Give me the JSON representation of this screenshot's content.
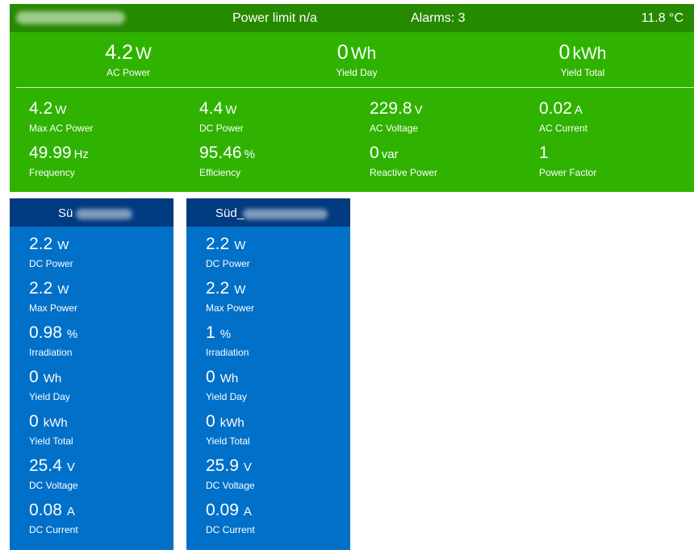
{
  "inverter": {
    "power_limit": "Power limit n/a",
    "alarms": "Alarms: 3",
    "temperature": "11.8 °C",
    "top_metrics": [
      {
        "value": "4.2",
        "unit": "W",
        "label": "AC Power"
      },
      {
        "value": "0",
        "unit": "Wh",
        "label": "Yield Day"
      },
      {
        "value": "0",
        "unit": "kWh",
        "label": "Yield Total"
      }
    ],
    "metrics": [
      {
        "value": "4.2",
        "unit": "W",
        "label": "Max AC Power"
      },
      {
        "value": "4.4",
        "unit": "W",
        "label": "DC Power"
      },
      {
        "value": "229.8",
        "unit": "V",
        "label": "AC Voltage"
      },
      {
        "value": "0.02",
        "unit": "A",
        "label": "AC Current"
      },
      {
        "value": "49.99",
        "unit": "Hz",
        "label": "Frequency"
      },
      {
        "value": "95.46",
        "unit": "%",
        "label": "Efficiency"
      },
      {
        "value": "0",
        "unit": "var",
        "label": "Reactive Power"
      },
      {
        "value": "1",
        "unit": "",
        "label": "Power Factor"
      }
    ]
  },
  "strings": [
    {
      "title": "Sü",
      "metrics": [
        {
          "value": "2.2",
          "unit": "W",
          "label": "DC Power"
        },
        {
          "value": "2.2",
          "unit": "W",
          "label": "Max Power"
        },
        {
          "value": "0.98",
          "unit": "%",
          "label": "Irradiation"
        },
        {
          "value": "0",
          "unit": "Wh",
          "label": "Yield Day"
        },
        {
          "value": "0",
          "unit": "kWh",
          "label": "Yield Total"
        },
        {
          "value": "25.4",
          "unit": "V",
          "label": "DC Voltage"
        },
        {
          "value": "0.08",
          "unit": "A",
          "label": "DC Current"
        }
      ]
    },
    {
      "title": "Süd_",
      "metrics": [
        {
          "value": "2.2",
          "unit": "W",
          "label": "DC Power"
        },
        {
          "value": "2.2",
          "unit": "W",
          "label": "Max Power"
        },
        {
          "value": "1",
          "unit": "%",
          "label": "Irradiation"
        },
        {
          "value": "0",
          "unit": "Wh",
          "label": "Yield Day"
        },
        {
          "value": "0",
          "unit": "kWh",
          "label": "Yield Total"
        },
        {
          "value": "25.9",
          "unit": "V",
          "label": "DC Voltage"
        },
        {
          "value": "0.09",
          "unit": "A",
          "label": "DC Current"
        }
      ]
    }
  ]
}
